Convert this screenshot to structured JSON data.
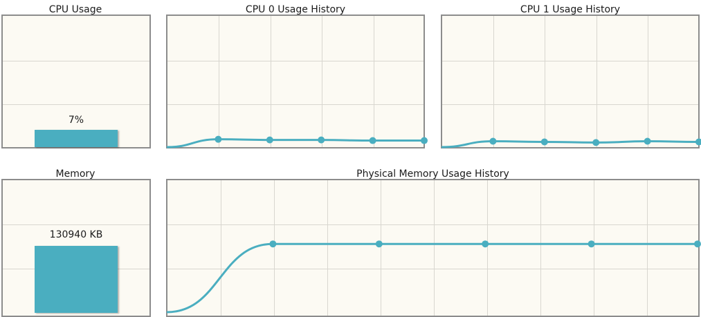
{
  "colors": {
    "accent": "#4aaec0",
    "panel_bg": "#fcfaf3",
    "grid": "#d8d6cf",
    "border": "#8c8c8c"
  },
  "cpu_usage": {
    "title": "CPU Usage",
    "label": "7%",
    "value_percent": 7
  },
  "memory": {
    "title": "Memory",
    "label": "130940 KB"
  },
  "cpu0_history": {
    "title": "CPU 0 Usage History"
  },
  "cpu1_history": {
    "title": "CPU 1 Usage History"
  },
  "mem_history": {
    "title": "Physical Memory Usage History"
  },
  "chart_data": [
    {
      "type": "bar",
      "title": "CPU Usage",
      "categories": [
        ""
      ],
      "values": [
        7
      ],
      "data_labels": [
        "7%"
      ],
      "ylim": [
        0,
        100
      ],
      "grid": true
    },
    {
      "type": "line",
      "title": "CPU 0 Usage History",
      "x": [
        0,
        1,
        2,
        3,
        4,
        5
      ],
      "values": [
        0,
        6,
        5.5,
        5.5,
        5,
        5
      ],
      "markers": [
        false,
        true,
        true,
        true,
        true,
        true
      ],
      "ylim": [
        0,
        100
      ],
      "grid": true
    },
    {
      "type": "line",
      "title": "CPU 1 Usage History",
      "x": [
        0,
        1,
        2,
        3,
        4,
        5
      ],
      "values": [
        0,
        4.5,
        4,
        3.5,
        4.5,
        4
      ],
      "markers": [
        false,
        true,
        true,
        true,
        true,
        true
      ],
      "ylim": [
        0,
        100
      ],
      "grid": true
    },
    {
      "type": "bar",
      "title": "Memory",
      "categories": [
        ""
      ],
      "values": [
        130940
      ],
      "data_labels": [
        "130940 KB"
      ],
      "grid": true
    },
    {
      "type": "line",
      "title": "Physical Memory Usage History",
      "x": [
        0,
        1,
        2,
        3,
        4,
        5
      ],
      "values": [
        0,
        52,
        52,
        52,
        52,
        52
      ],
      "markers": [
        false,
        true,
        true,
        true,
        true,
        true
      ],
      "ylim": [
        0,
        100
      ],
      "grid": true
    }
  ]
}
